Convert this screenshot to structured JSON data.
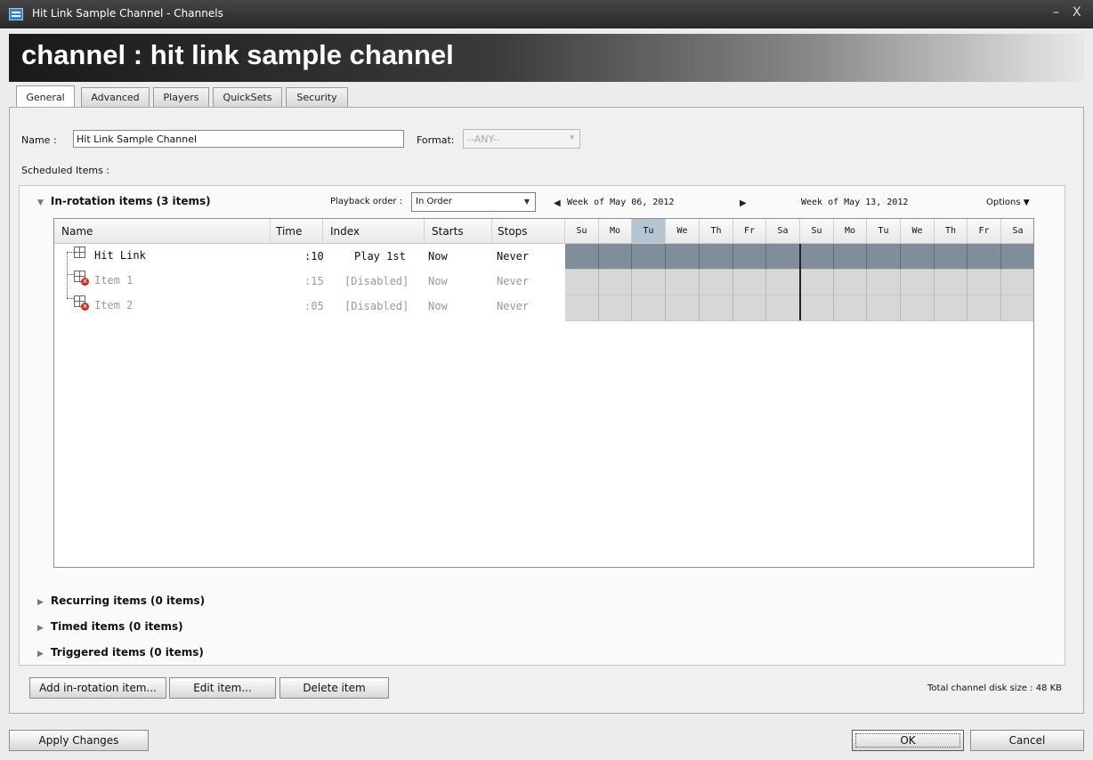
{
  "window": {
    "title": "Hit Link Sample Channel - Channels",
    "minimize": "–",
    "close": "X"
  },
  "banner": {
    "title": "channel : hit link sample channel"
  },
  "tabs": [
    {
      "label": "General",
      "active": true
    },
    {
      "label": "Advanced"
    },
    {
      "label": "Players"
    },
    {
      "label": "QuickSets"
    },
    {
      "label": "Security"
    }
  ],
  "general": {
    "name_label": "Name :",
    "name_value": "Hit Link Sample Channel",
    "format_label": "Format:",
    "format_value": "--ANY--",
    "scheduled_label": "Scheduled Items :"
  },
  "inrotation": {
    "header": "In-rotation items (3 items)",
    "playback_label": "Playback order :",
    "playback_value": "In Order",
    "week1": "Week of May 06, 2012",
    "week2": "Week of May 13, 2012",
    "options": "Options"
  },
  "columns": [
    "Name",
    "Time",
    "Index",
    "Starts",
    "Stops"
  ],
  "days": [
    "Su",
    "Mo",
    "Tu",
    "We",
    "Th",
    "Fr",
    "Sa",
    "Su",
    "Mo",
    "Tu",
    "We",
    "Th",
    "Fr",
    "Sa"
  ],
  "today_index": 2,
  "rows": [
    {
      "name": "Hit Link",
      "time": ":10",
      "index": "Play 1st",
      "starts": "Now",
      "stops": "Never",
      "disabled": false
    },
    {
      "name": "Item 1",
      "time": ":15",
      "index": "[Disabled]",
      "starts": "Now",
      "stops": "Never",
      "disabled": true
    },
    {
      "name": "Item 2",
      "time": ":05",
      "index": "[Disabled]",
      "starts": "Now",
      "stops": "Never",
      "disabled": true
    }
  ],
  "sections": {
    "recurring": "Recurring items (0 items)",
    "timed": "Timed items (0 items)",
    "triggered": "Triggered items (0 items)"
  },
  "actions": {
    "add": "Add in-rotation item...",
    "edit": "Edit item...",
    "delete": "Delete item",
    "disk_size": "Total channel disk size : 48 KB"
  },
  "footer": {
    "apply": "Apply Changes",
    "ok": "OK",
    "cancel": "Cancel"
  },
  "colors": {
    "day_on": "#7f8e9a",
    "day_off": "#d7d7d7",
    "today_header": "#b5c6d2"
  }
}
